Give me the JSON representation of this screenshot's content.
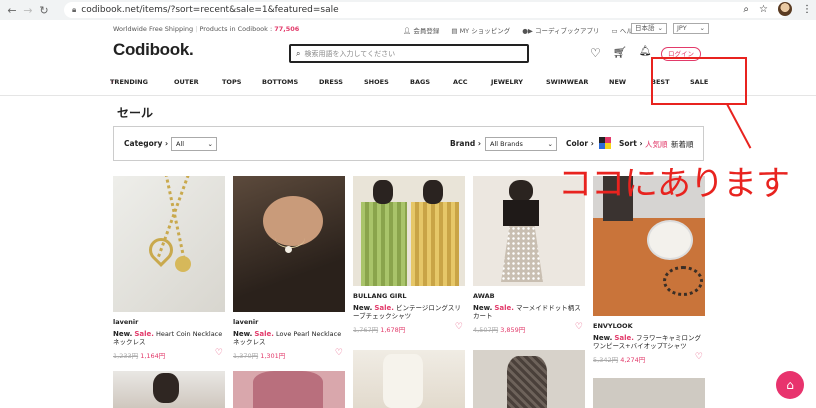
{
  "browser": {
    "url": "codibook.net/items/?sort=recent&sale=1&featured=sale"
  },
  "topstrip": {
    "free_shipping": "Worldwide Free Shipping",
    "products_label": "Products in Codibook :",
    "products_count": "77,506",
    "member": "会員登録",
    "myshop": "MY ショッピング",
    "app": "コーディブックアプリ",
    "help": "ヘルプ",
    "lang": "日本語",
    "currency": "JPY"
  },
  "header": {
    "logo": "Codibook.",
    "search_placeholder": "検索用語を入力してください",
    "login": "ログイン"
  },
  "menu": [
    "TRENDING",
    "OUTER",
    "TOPS",
    "BOTTOMS",
    "DRESS",
    "SHOES",
    "BAGS",
    "ACC",
    "JEWELRY",
    "SWIMWEAR",
    "NEW",
    "BEST",
    "SALE"
  ],
  "page": {
    "title": "セール"
  },
  "filters": {
    "category_label": "Category",
    "category_value": "All",
    "brand_label": "Brand",
    "brand_value": "All Brands",
    "color_label": "Color",
    "sort_label": "Sort",
    "sort_popular": "人気順",
    "sort_newest": "新着順"
  },
  "annotation": {
    "text": "ココにあります"
  },
  "products": [
    {
      "brand": "lavenir",
      "new": "New.",
      "sale": "Sale.",
      "name": "Heart Coin Necklace ネックレス",
      "old_price": "1,233円",
      "new_price": "1,164円"
    },
    {
      "brand": "lavenir",
      "new": "New.",
      "sale": "Sale.",
      "name": "Love Pearl Necklace ネックレス",
      "old_price": "1,370円",
      "new_price": "1,301円"
    },
    {
      "brand": "BULLANG GIRL",
      "new": "New.",
      "sale": "Sale.",
      "name": "ビンテージロングスリーブチェックシャツ",
      "old_price": "1,767円",
      "new_price": "1,678円"
    },
    {
      "brand": "AWAB",
      "new": "New.",
      "sale": "Sale.",
      "name": "マーメイドドット柄スカート",
      "old_price": "4,507円",
      "new_price": "3,859円"
    },
    {
      "brand": "ENVYLOOK",
      "new": "New.",
      "sale": "Sale.",
      "name": "フラワーキャミロングワンピース+バイオップTシャツ",
      "old_price": "5,342円",
      "new_price": "4,274円"
    }
  ],
  "colors": {
    "accent": "#e23a6a",
    "annotation": "#e8231f"
  }
}
